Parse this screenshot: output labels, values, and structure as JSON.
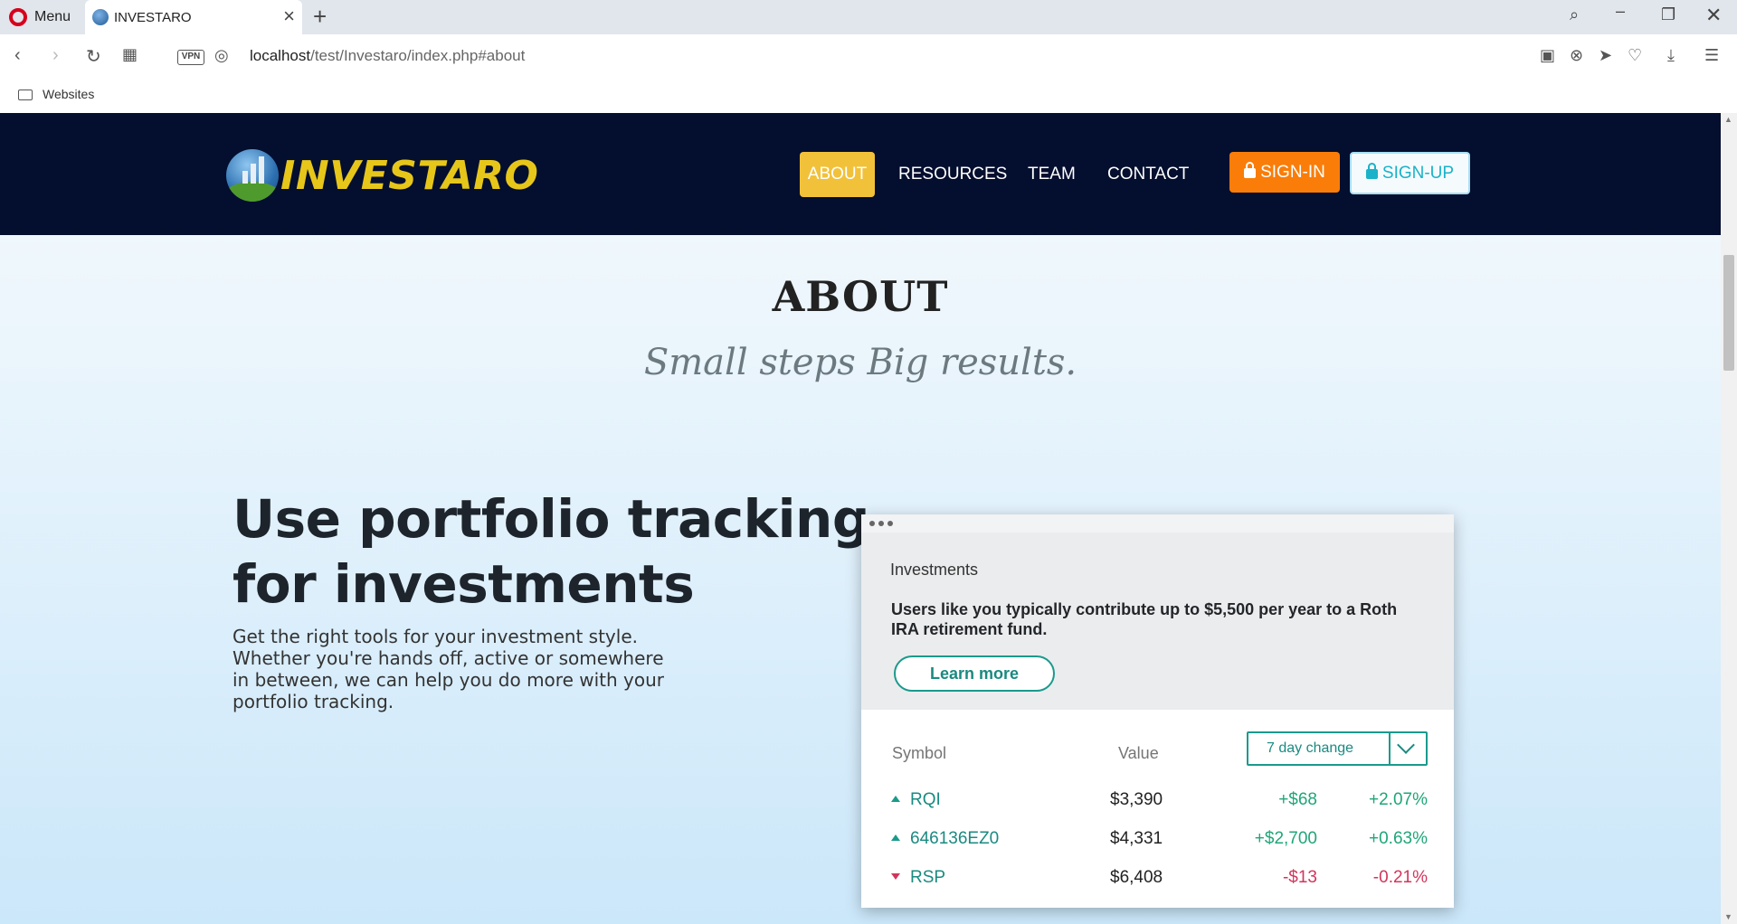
{
  "browser": {
    "menu_label": "Menu",
    "tab_title": "INVESTARO",
    "url_host": "localhost",
    "url_path": "/test/Investaro/index.php#about",
    "vpn_label": "VPN",
    "bookmark_folder": "Websites"
  },
  "site": {
    "brand": "INVESTARO",
    "nav": {
      "about": "ABOUT",
      "resources": "RESOURCES",
      "team": "TEAM",
      "contact": "CONTACT",
      "signin": "SIGN-IN",
      "signup": "SIGN-UP"
    },
    "colors": {
      "nav_bg": "#040e2e",
      "about_active": "#f2c13a",
      "signin_bg": "#f97d08",
      "signup_text": "#1ab2c8",
      "logo_text": "#e7c61a"
    }
  },
  "section": {
    "title": "ABOUT",
    "subtitle": "Small steps Big results."
  },
  "hero": {
    "heading": "Use portfolio tracking for investments",
    "paragraph": "Get the right tools for your investment style. Whether you're hands off, active or somewhere in between, we can help you do more with your portfolio tracking."
  },
  "card": {
    "label": "Investments",
    "message": "Users like you typically contribute up to $5,500 per year to a Roth IRA retirement fund.",
    "learn_more": "Learn more",
    "columns": {
      "symbol": "Symbol",
      "value": "Value"
    },
    "change_select": "7 day change",
    "rows": [
      {
        "symbol": "RQI",
        "value": "$3,390",
        "change": "+$68",
        "percent": "+2.07%",
        "direction": "up"
      },
      {
        "symbol": "646136EZ0",
        "value": "$4,331",
        "change": "+$2,700",
        "percent": "+0.63%",
        "direction": "up"
      },
      {
        "symbol": "RSP",
        "value": "$6,408",
        "change": "-$13",
        "percent": "-0.21%",
        "direction": "down"
      }
    ]
  }
}
